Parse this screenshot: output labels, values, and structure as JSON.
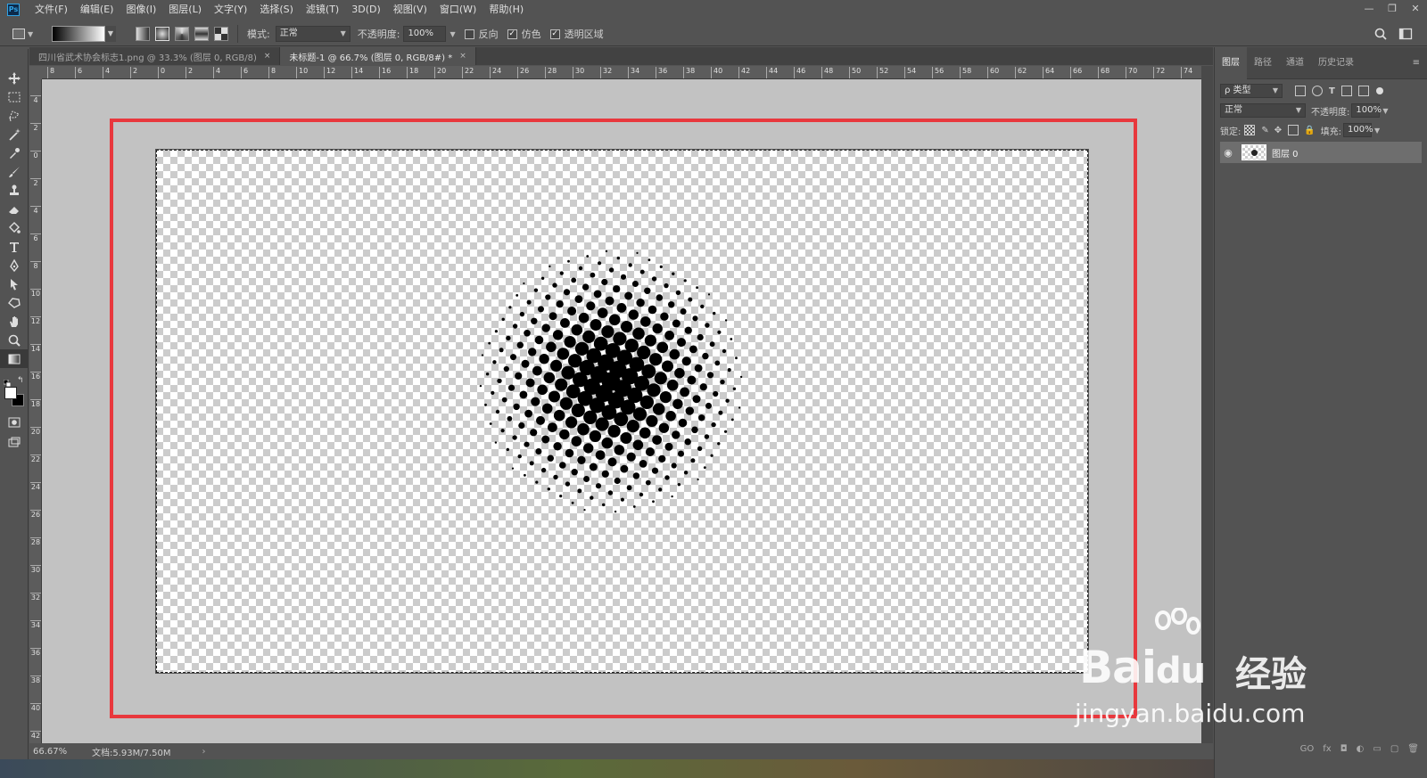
{
  "app": {
    "logo_text": "Ps"
  },
  "menu": [
    "文件(F)",
    "编辑(E)",
    "图像(I)",
    "图层(L)",
    "文字(Y)",
    "选择(S)",
    "滤镜(T)",
    "3D(D)",
    "视图(V)",
    "窗口(W)",
    "帮助(H)"
  ],
  "window_controls": {
    "minimize": "—",
    "restore": "❐",
    "close": "✕"
  },
  "options_bar": {
    "mode_label": "模式:",
    "mode_value": "正常",
    "opacity_label": "不透明度:",
    "opacity_value": "100%",
    "reverse_label": "反向",
    "reverse_checked": false,
    "dither_label": "仿色",
    "dither_checked": true,
    "transparency_label": "透明区域",
    "transparency_checked": true,
    "check_mark": "✓"
  },
  "doc_tabs": [
    {
      "title": "四川省武术协会标志1.png @ 33.3% (图层 0, RGB/8)",
      "close": "×",
      "active": false
    },
    {
      "title": "未标题-1 @ 66.7% (图层 0, RGB/8#) *",
      "close": "×",
      "active": true
    }
  ],
  "ruler_top_labels": [
    "8",
    "6",
    "4",
    "2",
    "0",
    "2",
    "4",
    "6",
    "8",
    "10",
    "12",
    "14",
    "16",
    "18",
    "20",
    "22",
    "24",
    "26",
    "28",
    "30",
    "32",
    "34",
    "36",
    "38",
    "40",
    "42",
    "44",
    "46",
    "48",
    "50",
    "52",
    "54",
    "56",
    "58",
    "60",
    "62",
    "64",
    "66",
    "68",
    "70",
    "72",
    "74"
  ],
  "ruler_left_labels": [
    "4",
    "2",
    "0",
    "2",
    "4",
    "6",
    "8",
    "10",
    "12",
    "14",
    "16",
    "18",
    "20",
    "22",
    "24",
    "26",
    "28",
    "30",
    "32",
    "34",
    "36",
    "38",
    "40",
    "42"
  ],
  "status": {
    "zoom": "66.67%",
    "doc_info": "文档:5.93M/7.50M",
    "arrow": "›"
  },
  "panel": {
    "tabs": [
      "图层",
      "路径",
      "通道",
      "历史记录"
    ],
    "menu_icon": "≡",
    "filter_label": "ρ 类型",
    "blend_mode": "正常",
    "opacity_label": "不透明度:",
    "opacity_value": "100%",
    "lock_label": "锁定:",
    "fill_label": "填充:",
    "fill_value": "100%",
    "layer_name": "图层 0",
    "eye": "👁",
    "footer_icons": [
      "GO",
      "fx",
      "◘",
      "◐",
      "▭",
      "▢",
      "🗑"
    ]
  },
  "watermark": {
    "brand": "Bai",
    "brand_tail": "du",
    "jingyan": "经验",
    "url": "jingyan.baidu.com"
  },
  "colors": {
    "highlight": "#e8383d",
    "ui_bg": "#535353",
    "workspace": "#c2c2c2"
  }
}
